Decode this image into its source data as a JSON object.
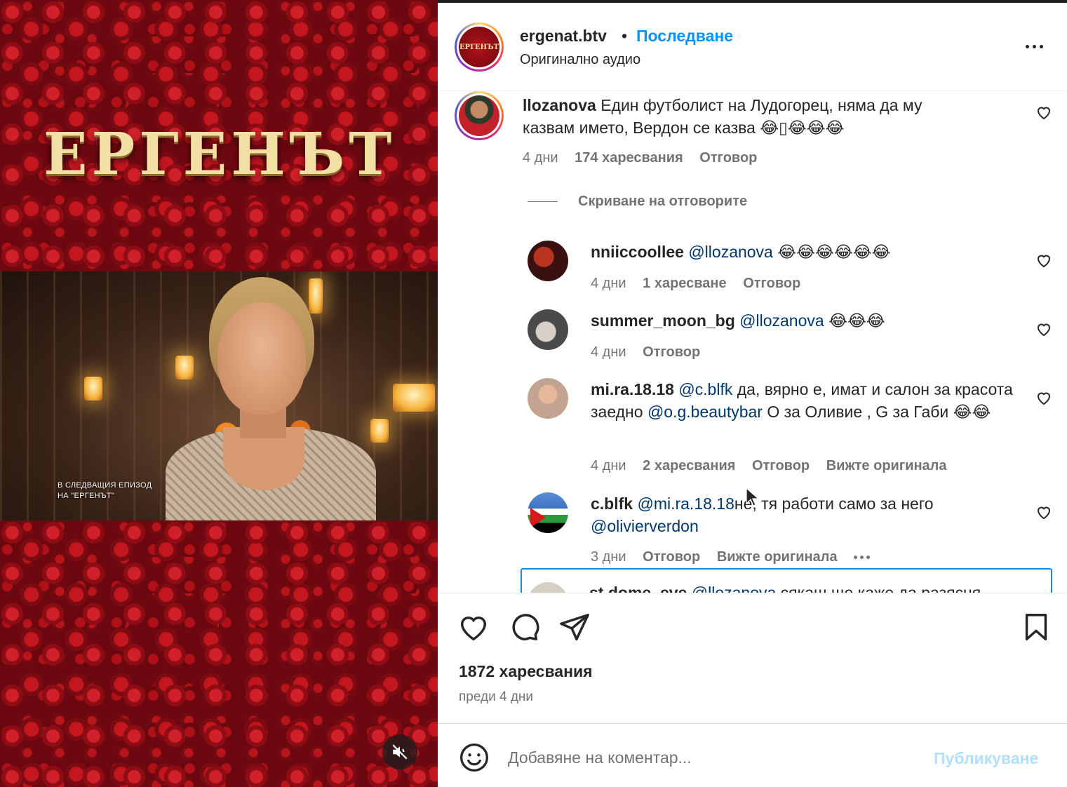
{
  "media": {
    "logo_text": "ЕРГЕНЪТ",
    "caption_line1": "В СЛЕДВАЩИЯ ЕПИЗОД",
    "caption_line2": "НА \"ЕРГЕНЪТ\"",
    "mute_icon": "speaker-muted-icon"
  },
  "header": {
    "username": "ergenat.btv",
    "separator": "•",
    "follow_label": "Последване",
    "subtitle": "Оригинално аудио",
    "avatar_text": "ЕРГЕНЪТ"
  },
  "comments": {
    "main": {
      "username": "llozanova",
      "text": "Един футболист на Лудогорец, няма да му казвам името, Вердон се казва 😂▯😂😂😂",
      "time": "4 дни",
      "likes": "174 харесвания",
      "reply": "Отговор"
    },
    "hide_replies": "Скриване на отговорите",
    "replies": [
      {
        "username": "nniiccoollee",
        "mention": "@llozanova",
        "text": "😂😂😂😂😂😂",
        "time": "4 дни",
        "likes": "1 харесване",
        "reply": "Отговор"
      },
      {
        "username": "summer_moon_bg",
        "mention": "@llozanova",
        "text": "😂😂😂",
        "time": "4 дни",
        "reply": "Отговор"
      },
      {
        "username": "mi.ra.18.18",
        "mention": "@c.blfk",
        "text_a": "да, вярно е, имат и салон за красота заедно",
        "mention_b": "@o.g.beautybar",
        "text_b": "О за Оливие , G за Габи 😂😂",
        "time": "4 дни",
        "likes": "2 харесвания",
        "reply": "Отговор",
        "see_original": "Вижте оригинала"
      },
      {
        "username": "c.blfk",
        "mention": "@mi.ra.18.18",
        "text_a": "не, тя работи само за него",
        "mention_b": "@olivierverdon",
        "time": "3 дни",
        "reply": "Отговор",
        "see_original": "Вижте оригинала"
      }
    ],
    "partial": {
      "username": "st.dome_eve",
      "mention": "@llozanova",
      "text": "сякаш ще каже да разясня"
    }
  },
  "actions": {
    "like_icon": "heart-icon",
    "comment_icon": "comment-bubble-icon",
    "share_icon": "paper-plane-icon",
    "save_icon": "bookmark-icon",
    "likes_count": "1872 харесвания",
    "posted": "преди 4 дни"
  },
  "add_comment": {
    "placeholder": "Добавяне на коментар...",
    "publish_label": "Публикуване",
    "emoji_icon": "smiley-icon"
  },
  "colors": {
    "accent": "#0095f6",
    "mention": "#00376b",
    "muted_text": "#737373",
    "publish_disabled": "#b2dffc"
  }
}
